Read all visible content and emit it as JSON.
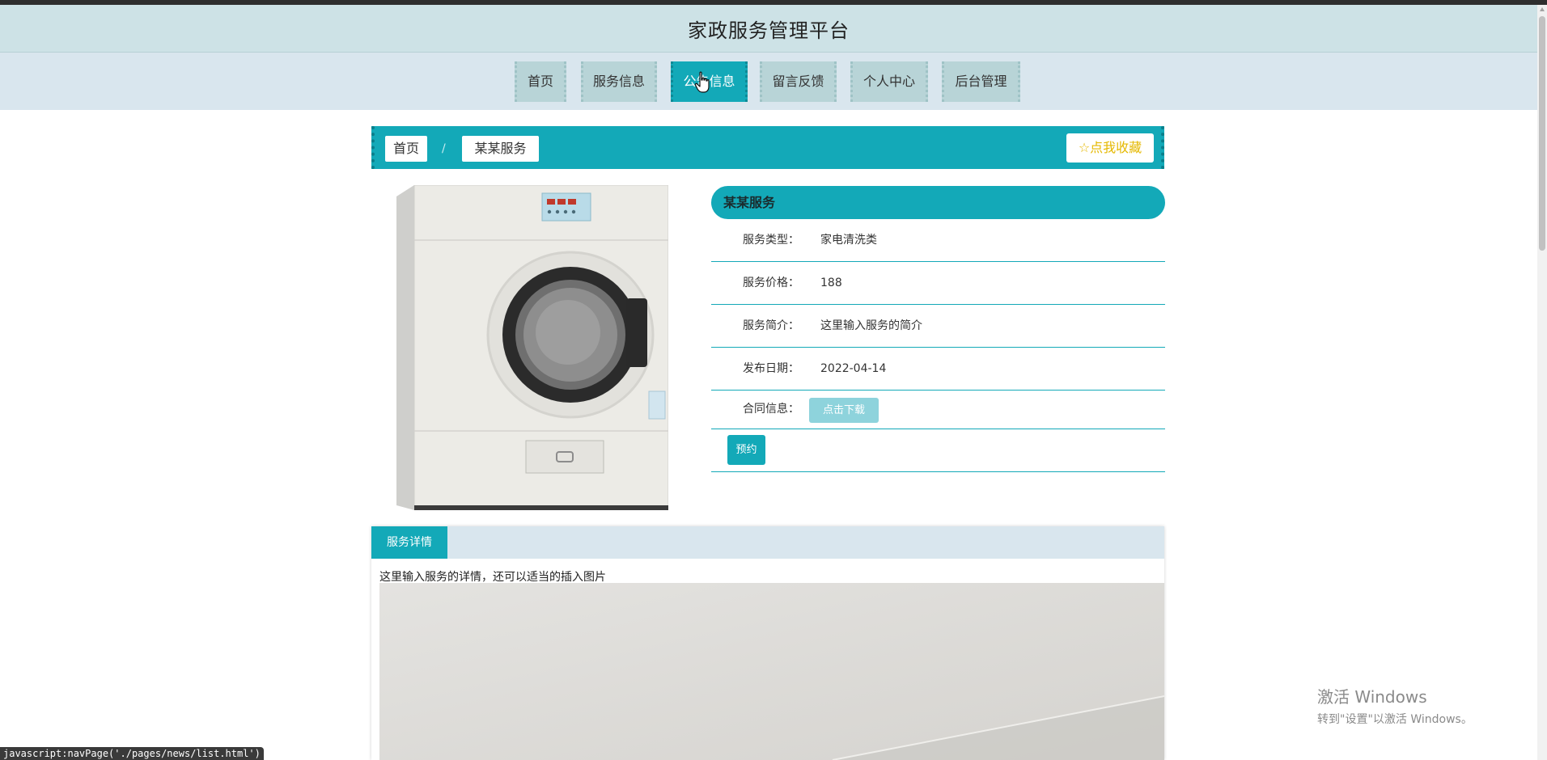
{
  "header": {
    "title": "家政服务管理平台"
  },
  "nav": {
    "items": [
      {
        "label": "首页"
      },
      {
        "label": "服务信息"
      },
      {
        "label": "公告信息"
      },
      {
        "label": "留言反馈"
      },
      {
        "label": "个人中心"
      },
      {
        "label": "后台管理"
      }
    ],
    "active_index": 2
  },
  "breadcrumb": {
    "home": "首页",
    "separator": "/",
    "current": "某某服务"
  },
  "favorite": {
    "icon": "star-outline-icon",
    "label": "点我收藏"
  },
  "product": {
    "image_alt": "washing-machine",
    "title": "某某服务",
    "rows": [
      {
        "label": "服务类型：",
        "value": "家电清洗类"
      },
      {
        "label": "服务价格：",
        "value": "188"
      },
      {
        "label": "服务简介：",
        "value": "这里输入服务的简介"
      },
      {
        "label": "发布日期：",
        "value": "2022-04-14"
      }
    ],
    "contract": {
      "label": "合同信息：",
      "button": "点击下载"
    },
    "book_button": "预约"
  },
  "detail": {
    "tab": "服务详情",
    "text": "这里输入服务的详情，还可以适当的插入图片"
  },
  "statusbar": {
    "text": "javascript:navPage('./pages/news/list.html')"
  },
  "os_watermark": {
    "line1": "激活 Windows",
    "line2": "转到\"设置\"以激活 Windows。"
  },
  "colors": {
    "accent": "#13a9b8",
    "header_bg": "#cde2e6",
    "nav_bg": "#d9e6ee",
    "nav_item_bg": "#b8d4d7",
    "favorite_text": "#e5b800"
  }
}
